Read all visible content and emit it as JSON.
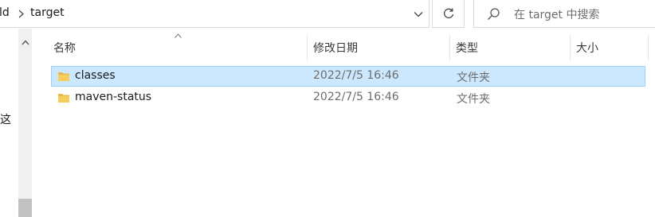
{
  "address_bar": {
    "previous_crumb": "ld",
    "current_folder": "target"
  },
  "search": {
    "placeholder": "在 target 中搜索"
  },
  "nav_pane": {
    "visible_text": "这"
  },
  "columns": {
    "name": "名称",
    "modified": "修改日期",
    "type": "类型",
    "size": "大小"
  },
  "files": [
    {
      "name": "classes",
      "modified": "2022/7/5 16:46",
      "type": "文件夹",
      "selected": true
    },
    {
      "name": "maven-status",
      "modified": "2022/7/5 16:46",
      "type": "文件夹",
      "selected": false
    }
  ],
  "icons": {
    "folder": "folder-icon",
    "breadcrumb_separator": "chevron-right-icon",
    "address_dropdown": "chevron-down-icon",
    "refresh": "refresh-icon",
    "search": "search-icon",
    "sort": "sort-ascending-icon",
    "scroll_up": "scroll-up-icon"
  },
  "colors": {
    "selection_fill": "#cce8ff",
    "selection_border": "#99d1ff",
    "folder": "#e8b84a"
  }
}
